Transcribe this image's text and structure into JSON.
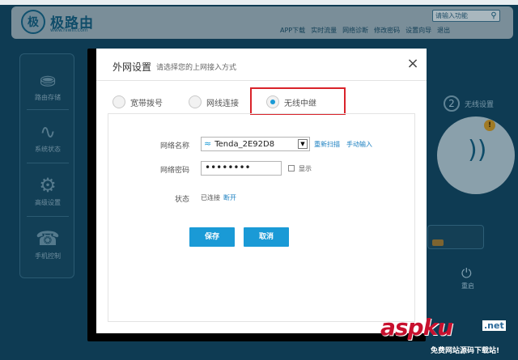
{
  "app": {
    "logo_mark": "极",
    "logo_text": "极路由",
    "logo_url": "www.hiwifi.com",
    "search_placeholder": "请输入功能",
    "top_links": [
      "APP下载",
      "实时流量",
      "网络诊断",
      "修改密码",
      "设置向导",
      "退出"
    ]
  },
  "sidebar": {
    "items": [
      {
        "label": "路由存储",
        "icon": "storage-icon"
      },
      {
        "label": "系统状态",
        "icon": "pulse-icon"
      },
      {
        "label": "高级设置",
        "icon": "gear-icon"
      },
      {
        "label": "手机控制",
        "icon": "phone-icon"
      }
    ]
  },
  "right_panel": {
    "step_number": "2",
    "step_label": "无线设置",
    "alert": "!",
    "power_label": "重启"
  },
  "modal": {
    "title": "外网设置",
    "subtitle": "请选择您的上网接入方式",
    "close_icon": "×",
    "tabs": [
      {
        "label": "宽带拨号",
        "checked": false
      },
      {
        "label": "网线连接",
        "checked": false
      },
      {
        "label": "无线中继",
        "checked": true
      }
    ],
    "form": {
      "ssid_label": "网络名称",
      "ssid_value": "Tenda_2E92D8",
      "rescan_link": "重新扫描",
      "manual_link": "手动输入",
      "password_label": "网络密码",
      "password_value": "••••••••",
      "show_label": "显示",
      "status_label": "状态",
      "status_value": "已连接",
      "disconnect_link": "断开",
      "save_button": "保存",
      "cancel_button": "取消"
    }
  },
  "watermark": {
    "brand": "aspku",
    "tld": ".net",
    "tagline": "免费网站源码下载站!"
  },
  "colors": {
    "accent": "#1a9ad6",
    "highlight": "#d9232a",
    "backdrop": "#0e3b53"
  }
}
